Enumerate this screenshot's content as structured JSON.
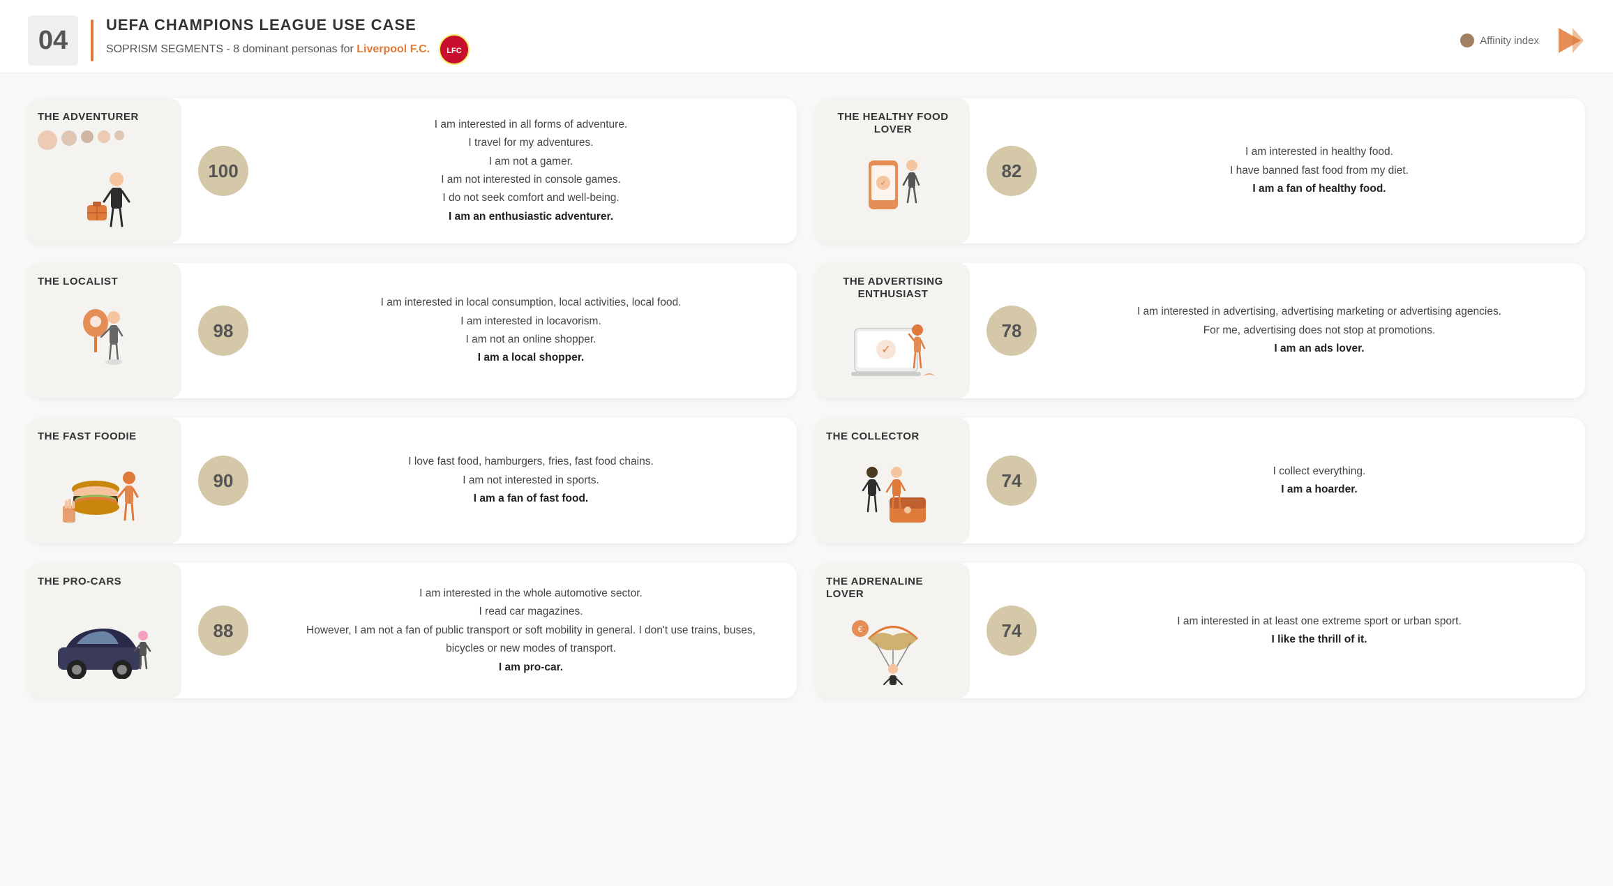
{
  "header": {
    "page_number": "04",
    "title": "UEFA CHAMPIONS LEAGUE USE CASE",
    "subtitle_prefix": "SOPRISM SEGMENTS - 8 dominant personas for ",
    "club_name": "Liverpool F.C.",
    "affinity_label": "Affinity index"
  },
  "personas": [
    {
      "id": "adventurer",
      "name": "THE ADVENTURER",
      "score": "100",
      "description_lines": [
        "I am interested in all forms of adventure.",
        "I travel for my adventures.",
        "I am not a gamer.",
        "I am not interested in console games.",
        "I do not seek comfort and well-being."
      ],
      "highlight": "I am an enthusiastic adventurer.",
      "color": "#f5f3f0"
    },
    {
      "id": "healthy-food-lover",
      "name": "THE HEALTHY FOOD LOVER",
      "score": "82",
      "description_lines": [
        "I am interested in healthy food.",
        "I have banned fast food from my diet."
      ],
      "highlight": "I am a fan of healthy food.",
      "color": "#f5f3f0"
    },
    {
      "id": "localist",
      "name": "THE LOCALIST",
      "score": "98",
      "description_lines": [
        "I am interested in local consumption, local activities,",
        "local food.",
        "I am interested in locavorism.",
        "I am not an online shopper."
      ],
      "highlight": "I am a local shopper.",
      "color": "#f5f3f0"
    },
    {
      "id": "advertising-enthusiast",
      "name": "THE ADVERTISING ENTHUSIAST",
      "score": "78",
      "description_lines": [
        "I am interested in advertising, advertising marketing or",
        "advertising agencies.",
        "For me, advertising does not stop at promotions."
      ],
      "highlight": "I am an ads lover.",
      "color": "#f5f3f0"
    },
    {
      "id": "fast-foodie",
      "name": "THE FAST FOODIE",
      "score": "90",
      "description_lines": [
        "I love fast food, hamburgers, fries, fast food chains.",
        "I am not interested in sports."
      ],
      "highlight": "I am a fan of fast food.",
      "color": "#f5f3f0"
    },
    {
      "id": "collector",
      "name": "THE COLLECTOR",
      "score": "74",
      "description_lines": [
        "I collect everything."
      ],
      "highlight": "I am a hoarder.",
      "color": "#f5f3f0"
    },
    {
      "id": "pro-cars",
      "name": "THE PRO-CARS",
      "score": "88",
      "description_lines": [
        "I am interested in the whole automotive sector.",
        "I read car magazines.",
        "However, I am not a fan of public transport or soft mobility in",
        "general. I don't use trains, buses, bicycles or new modes of",
        "transport."
      ],
      "highlight": "I am pro-car.",
      "color": "#f5f3f0"
    },
    {
      "id": "adrenaline-lover",
      "name": "THE ADRENALINE LOVER",
      "score": "74",
      "description_lines": [
        "I am interested in at least one extreme sport or urban sport."
      ],
      "highlight": "I like the thrill of it.",
      "color": "#f5f3f0"
    }
  ]
}
